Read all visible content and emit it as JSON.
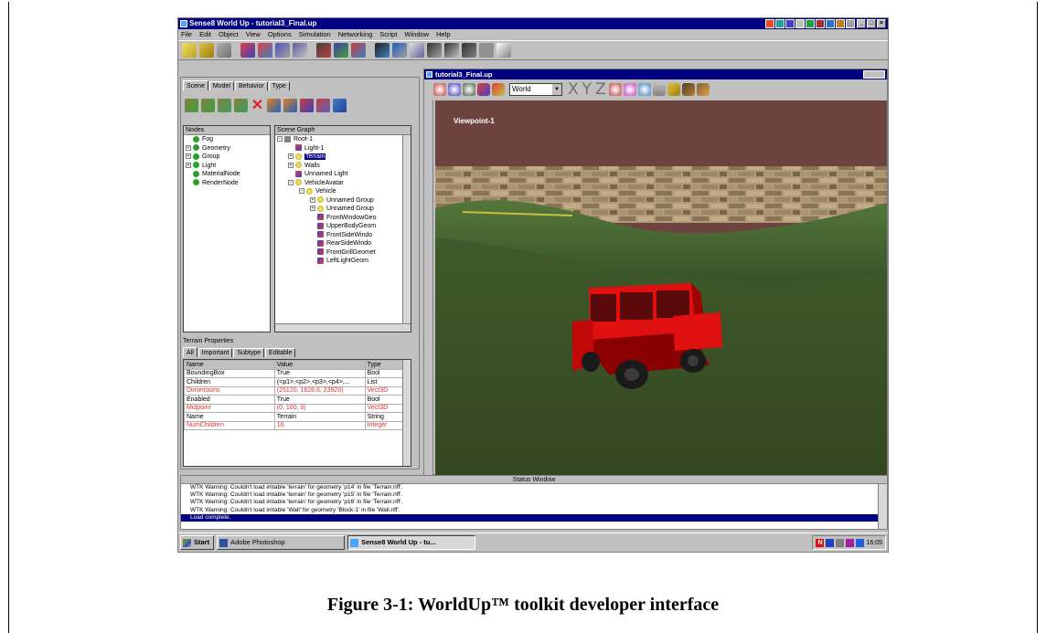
{
  "caption": "Figure 3-1: WorldUp™ toolkit developer interface",
  "app": {
    "title": "Sense8 World Up - tutorial3_Final.up",
    "window_buttons": [
      "_",
      "□",
      "×"
    ]
  },
  "menu": [
    "File",
    "Edit",
    "Object",
    "View",
    "Options",
    "Simulation",
    "Networking",
    "Script",
    "Window",
    "Help"
  ],
  "tabs": [
    "Scene",
    "Model",
    "Behavior",
    "Type"
  ],
  "nodes": {
    "header": "Nodes",
    "items": [
      "Fog",
      "Geometry",
      "Group",
      "Light",
      "MaterialNode",
      "RenderNode"
    ]
  },
  "scene_graph": {
    "header": "Scene Graph",
    "items": [
      {
        "label": "Root-1",
        "indent": 0
      },
      {
        "label": "Light-1",
        "indent": 1
      },
      {
        "label": "Terrain",
        "indent": 1
      },
      {
        "label": "Walls",
        "indent": 1
      },
      {
        "label": "Unnamed Light",
        "indent": 1
      },
      {
        "label": "VehicleAvatar",
        "indent": 1
      },
      {
        "label": "Vehicle",
        "indent": 2
      },
      {
        "label": "Unnamed Group",
        "indent": 3
      },
      {
        "label": "Unnamed Group",
        "indent": 3
      },
      {
        "label": "FrontWindowGeo",
        "indent": 3
      },
      {
        "label": "UpperBodyGeom",
        "indent": 3
      },
      {
        "label": "FrontSideWindo",
        "indent": 3
      },
      {
        "label": "RearSideWindo",
        "indent": 3
      },
      {
        "label": "FrontGrillGeomet",
        "indent": 3
      },
      {
        "label": "LeftLightGeom",
        "indent": 3
      }
    ]
  },
  "properties": {
    "title": "Terrain Properties",
    "tabs": [
      "All",
      "Important",
      "Subtype",
      "Editable"
    ],
    "columns": [
      "Name",
      "Value",
      "Type"
    ],
    "rows": [
      {
        "name": "BoundingBox",
        "value": "True",
        "type": "Bool",
        "highlight": false
      },
      {
        "name": "Children",
        "value": "(<p1>,<p2>,<p3>,<p4>,...",
        "type": "List",
        "highlight": false
      },
      {
        "name": "Dimensions",
        "value": "(25120, 1628.6, 23920)",
        "type": "Vect3D",
        "highlight": true
      },
      {
        "name": "Enabled",
        "value": "True",
        "type": "Bool",
        "highlight": false
      },
      {
        "name": "Midpoint",
        "value": "(0, 100, 0)",
        "type": "Vect3D",
        "highlight": true
      },
      {
        "name": "Name",
        "value": "Terrain",
        "type": "String",
        "highlight": false
      },
      {
        "name": "NumChildren",
        "value": "16",
        "type": "Integer",
        "highlight": true
      }
    ]
  },
  "viewport": {
    "title": "tutorial3_Final.up",
    "frame_selector": "World",
    "axes": [
      "X",
      "Y",
      "Z"
    ],
    "label": "Viewpoint-1"
  },
  "status": {
    "title": "Status Window",
    "messages": [
      "WTK Warning: Couldn't load imtable 'terrain' for geometry 'p14' in file 'Terrain.nff'.",
      "WTK Warning: Couldn't load imtable 'terrain' for geometry 'p15' in file 'Terrain.nff'.",
      "WTK Warning: Couldn't load imtable 'terrain' for geometry 'p16' in file 'Terrain.nff'.",
      "WTK Warning: Couldn't load imtable 'Wall' for geometry 'Block-1' in file 'Wall.nff'.",
      "Load complete."
    ]
  },
  "taskbar": {
    "start": "Start",
    "items": [
      "Adobe Photoshop",
      "Sense8 World Up - tu..."
    ],
    "clock": "16:05"
  }
}
